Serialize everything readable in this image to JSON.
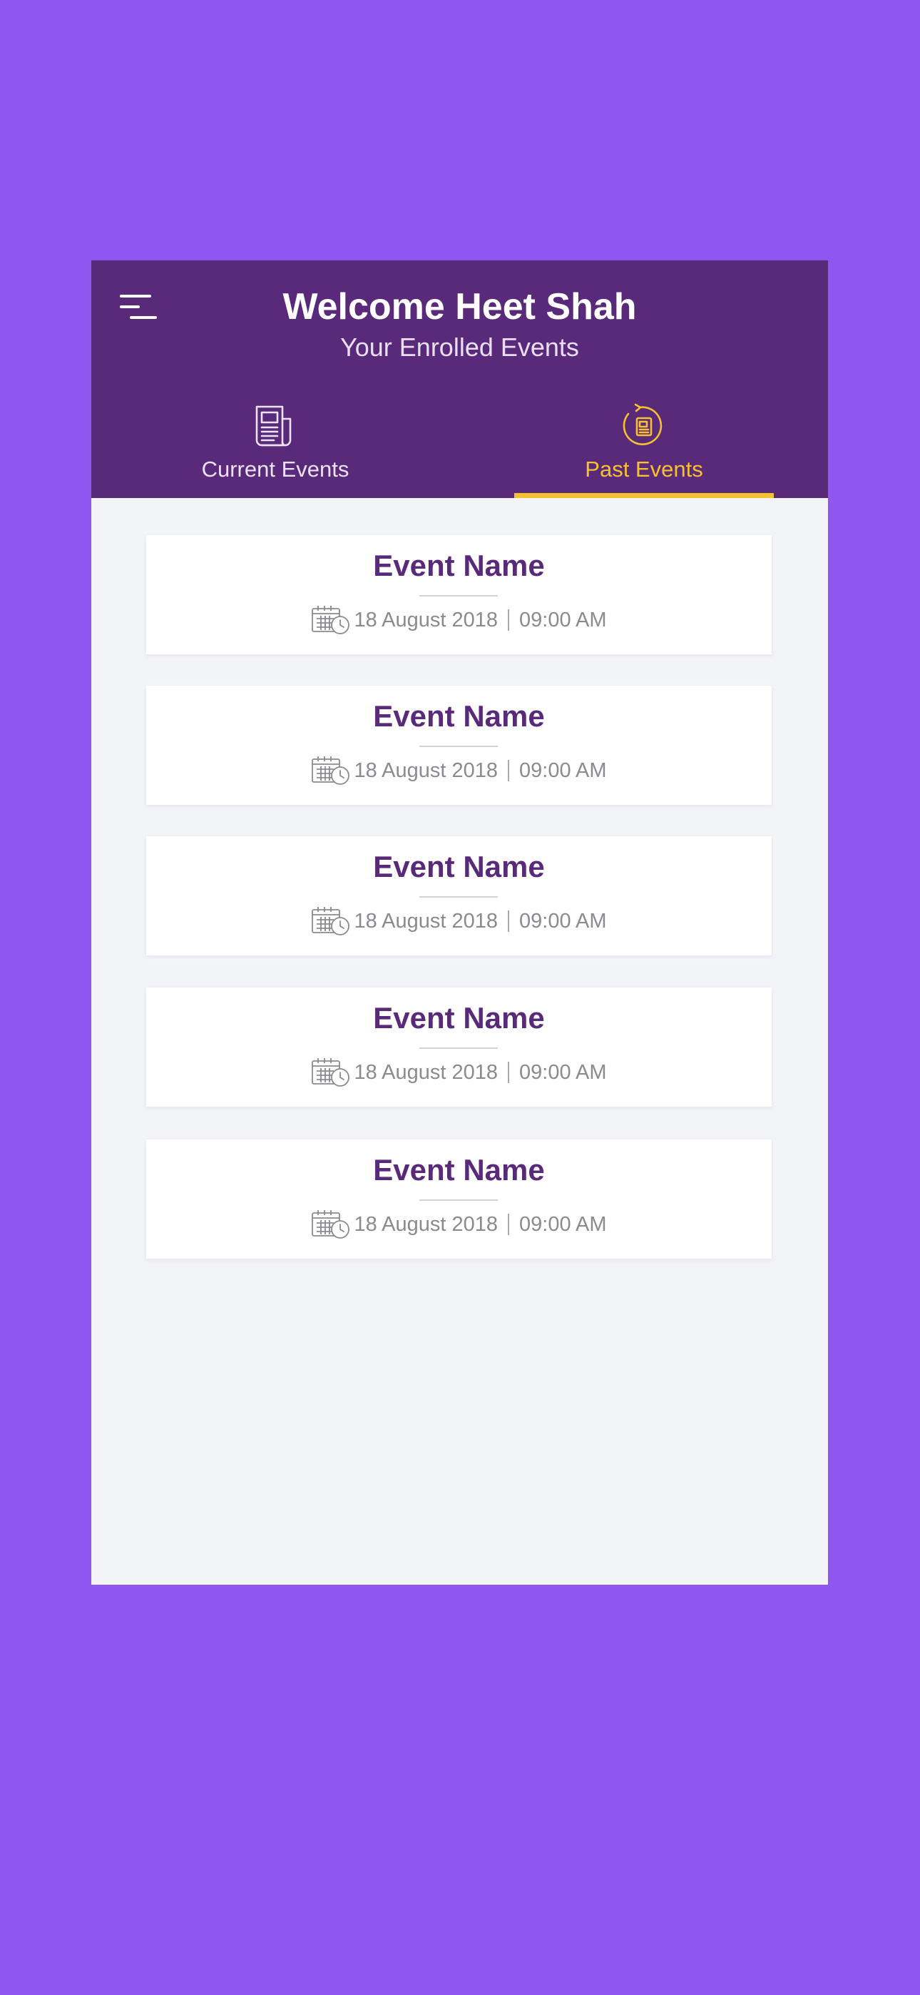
{
  "header": {
    "title": "Welcome Heet Shah",
    "subtitle": "Your Enrolled Events",
    "menu_icon": "hamburger-menu-icon"
  },
  "tabs": [
    {
      "label": "Current Events",
      "icon": "newspaper-icon",
      "active": false
    },
    {
      "label": "Past Events",
      "icon": "history-icon",
      "active": true
    }
  ],
  "colors": {
    "background": "#8f57ef",
    "header": "#5a2a7a",
    "accent": "#f6c12e",
    "content_bg": "#f3f4f8",
    "card_title": "#5a2a7a",
    "meta_text": "#8b8b8f"
  },
  "events": [
    {
      "name": "Event Name",
      "date": "18 August 2018",
      "time": "09:00 AM",
      "icon": "calendar-clock-icon"
    },
    {
      "name": "Event Name",
      "date": "18 August 2018",
      "time": "09:00 AM",
      "icon": "calendar-clock-icon"
    },
    {
      "name": "Event Name",
      "date": "18 August 2018",
      "time": "09:00 AM",
      "icon": "calendar-clock-icon"
    },
    {
      "name": "Event Name",
      "date": "18 August 2018",
      "time": "09:00 AM",
      "icon": "calendar-clock-icon"
    },
    {
      "name": "Event Name",
      "date": "18 August 2018",
      "time": "09:00 AM",
      "icon": "calendar-clock-icon"
    }
  ]
}
